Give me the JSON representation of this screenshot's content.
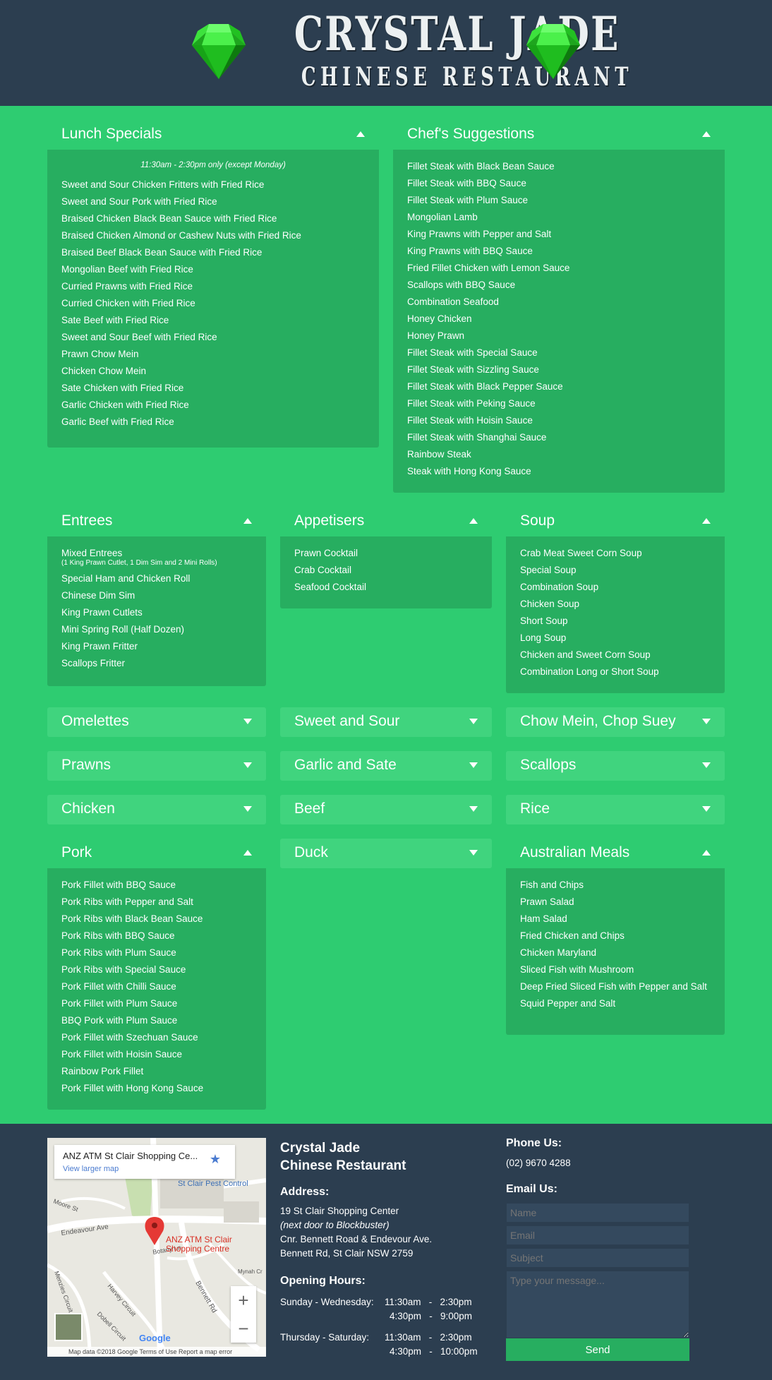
{
  "header": {
    "title": "CRYSTAL JADE",
    "subtitle": "CHINESE RESTAURANT"
  },
  "lunch": {
    "title": "Lunch Specials",
    "note": "11:30am - 2:30pm only (except Monday)",
    "items": [
      "Sweet and Sour Chicken Fritters with Fried Rice",
      "Sweet and Sour Pork with Fried Rice",
      "Braised Chicken Black Bean Sauce with Fried Rice",
      "Braised Chicken Almond or Cashew Nuts with Fried Rice",
      "Braised Beef Black Bean Sauce with Fried Rice",
      "Mongolian Beef with Fried Rice",
      "Curried Prawns with Fried Rice",
      "Curried Chicken with Fried Rice",
      "Sate Beef with Fried Rice",
      "Sweet and Sour Beef with Fried Rice",
      "Prawn Chow Mein",
      "Chicken Chow Mein",
      "Sate Chicken with Fried Rice",
      "Garlic Chicken with Fried Rice",
      "Garlic Beef with Fried Rice"
    ]
  },
  "chef": {
    "title": "Chef's Suggestions",
    "items": [
      "Fillet Steak with Black Bean Sauce",
      "Fillet Steak with BBQ Sauce",
      "Fillet Steak with Plum Sauce",
      "Mongolian Lamb",
      "King Prawns with Pepper and Salt",
      "King Prawns with BBQ Sauce",
      "Fried Fillet Chicken with Lemon Sauce",
      "Scallops with BBQ Sauce",
      "Combination Seafood",
      "Honey Chicken",
      "Honey Prawn",
      "Fillet Steak with Special Sauce",
      "Fillet Steak with Sizzling Sauce",
      "Fillet Steak with Black Pepper Sauce",
      "Fillet Steak with Peking Sauce",
      "Fillet Steak with Hoisin Sauce",
      "Fillet Steak with Shanghai Sauce",
      "Rainbow Steak",
      "Steak with Hong Kong Sauce"
    ]
  },
  "entrees": {
    "title": "Entrees",
    "first_item": "Mixed Entrees",
    "first_item_note": "(1 King Prawn Cutlet, 1 Dim Sim and 2 Mini Rolls)",
    "items": [
      "Special Ham and Chicken Roll",
      "Chinese Dim Sim",
      "King Prawn Cutlets",
      "Mini Spring Roll (Half Dozen)",
      "King Prawn Fritter",
      "Scallops Fritter"
    ]
  },
  "appetisers": {
    "title": "Appetisers",
    "items": [
      "Prawn Cocktail",
      "Crab Cocktail",
      "Seafood Cocktail"
    ]
  },
  "soup": {
    "title": "Soup",
    "items": [
      "Crab Meat Sweet Corn Soup",
      "Special Soup",
      "Combination Soup",
      "Chicken Soup",
      "Short Soup",
      "Long Soup",
      "Chicken and Sweet Corn Soup",
      "Combination Long or Short Soup"
    ]
  },
  "collapsed": {
    "omelettes": "Omelettes",
    "sweet_sour": "Sweet and Sour",
    "chow_mein": "Chow Mein, Chop Suey",
    "prawns": "Prawns",
    "garlic_sate": "Garlic and Sate",
    "scallops": "Scallops",
    "chicken": "Chicken",
    "beef": "Beef",
    "rice": "Rice",
    "duck": "Duck"
  },
  "pork": {
    "title": "Pork",
    "items": [
      "Pork Fillet with BBQ Sauce",
      "Pork Ribs with Pepper and Salt",
      "Pork Ribs with Black Bean Sauce",
      "Pork Ribs with BBQ Sauce",
      "Pork Ribs with Plum Sauce",
      "Pork Ribs with Special Sauce",
      "Pork Fillet with Chilli Sauce",
      "Pork Fillet with Plum Sauce",
      "BBQ Pork with Plum Sauce",
      "Pork Fillet with Szechuan Sauce",
      "Pork Fillet with Hoisin Sauce",
      "Rainbow Pork Fillet",
      "Pork Fillet with Hong Kong Sauce"
    ]
  },
  "australian": {
    "title": "Australian Meals",
    "items": [
      "Fish and Chips",
      "Prawn Salad",
      "Ham Salad",
      "Fried Chicken and Chips",
      "Chicken Maryland",
      "Sliced Fish with Mushroom",
      "Deep Fried Sliced Fish with Pepper and Salt",
      "Squid Pepper and Salt"
    ]
  },
  "map": {
    "place": "ANZ ATM St Clair Shopping Ce...",
    "link": "View larger map",
    "marker_label_1": "ANZ ATM St Clair",
    "marker_label_2": "Shopping Centre",
    "attribution": "Map data ©2018 Google    Terms of Use    Report a map error",
    "brand": "Google",
    "streets": [
      "Endeavour Ave",
      "St Clair Pest Control",
      "Bennett Rd",
      "Botany Ln",
      "Harvey Circuit",
      "Menzies Circuit",
      "Moore St",
      "Dobell Circuit",
      "Mynah Cr"
    ]
  },
  "footer": {
    "name_line1": "Crystal Jade",
    "name_line2": "Chinese Restaurant",
    "address_label": "Address:",
    "address_line1": "19 St Clair Shopping Center",
    "address_line2": "(next door to Blockbuster)",
    "address_line3": "Cnr. Bennett Road & Endevour Ave.",
    "address_line4": "Bennett Rd, St Clair NSW 2759",
    "hours_label": "Opening Hours:",
    "hours": {
      "days1": "Sunday - Wednesday:",
      "days1_a": "11:30am   -   2:30pm",
      "days1_b": "4:30pm   -   9:00pm",
      "days2": "Thursday - Saturday:",
      "days2_a": "11:30am   -   2:30pm",
      "days2_b": "4:30pm   -   10:00pm"
    },
    "phone_label": "Phone Us:",
    "phone": "(02) 9670 4288",
    "email_label": "Email Us:",
    "form": {
      "name_placeholder": "Name",
      "email_placeholder": "Email",
      "subject_placeholder": "Subject",
      "message_placeholder": "Type your message...",
      "send_label": "Send"
    }
  },
  "colors": {
    "page_bg": "#2ecc71",
    "panel_body": "#27ae60",
    "collapsed_head": "#40d47e",
    "header_bg": "#2c3e50"
  }
}
